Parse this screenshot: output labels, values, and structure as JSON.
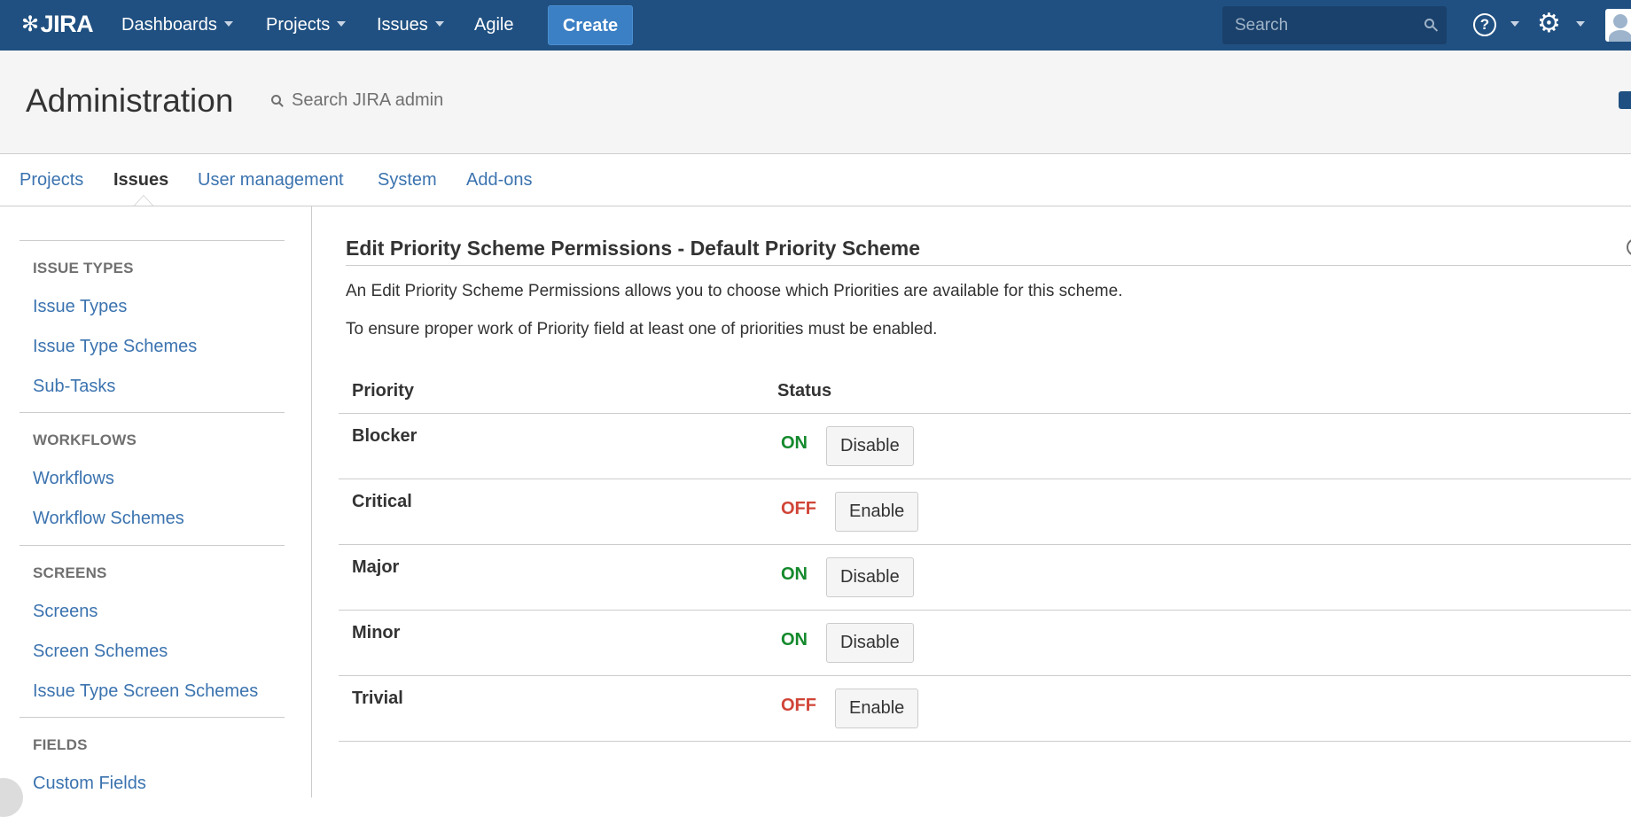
{
  "topnav": {
    "logo": "JIRA",
    "items": [
      {
        "label": "Dashboards",
        "has_dropdown": true
      },
      {
        "label": "Projects",
        "has_dropdown": true
      },
      {
        "label": "Issues",
        "has_dropdown": true
      },
      {
        "label": "Agile",
        "has_dropdown": false
      }
    ],
    "create_label": "Create",
    "search_placeholder": "Search",
    "help_glyph": "?",
    "icons": [
      "search-icon",
      "help-icon",
      "gear-icon",
      "avatar"
    ]
  },
  "admin_header": {
    "title": "Administration",
    "search_placeholder": "Search JIRA admin"
  },
  "admin_tabs": [
    {
      "label": "Projects",
      "active": false
    },
    {
      "label": "Issues",
      "active": true
    },
    {
      "label": "User management",
      "active": false
    },
    {
      "label": "System",
      "active": false
    },
    {
      "label": "Add-ons",
      "active": false
    }
  ],
  "sidebar": {
    "sections": [
      {
        "heading": "ISSUE TYPES",
        "items": [
          "Issue Types",
          "Issue Type Schemes",
          "Sub-Tasks"
        ]
      },
      {
        "heading": "WORKFLOWS",
        "items": [
          "Workflows",
          "Workflow Schemes"
        ]
      },
      {
        "heading": "SCREENS",
        "items": [
          "Screens",
          "Screen Schemes",
          "Issue Type Screen Schemes"
        ]
      },
      {
        "heading": "FIELDS",
        "items": [
          "Custom Fields"
        ]
      }
    ]
  },
  "main": {
    "heading": "Edit Priority Scheme Permissions - Default Priority Scheme",
    "description_1": "An Edit Priority Scheme Permissions allows you to choose which Priorities are available for this scheme.",
    "description_2": "To ensure proper work of Priority field at least one of priorities must be enabled.",
    "table": {
      "columns": [
        "Priority",
        "Status"
      ],
      "rows": [
        {
          "priority": "Blocker",
          "status": "ON",
          "action": "Disable"
        },
        {
          "priority": "Critical",
          "status": "OFF",
          "action": "Enable"
        },
        {
          "priority": "Major",
          "status": "ON",
          "action": "Disable"
        },
        {
          "priority": "Minor",
          "status": "ON",
          "action": "Disable"
        },
        {
          "priority": "Trivial",
          "status": "OFF",
          "action": "Enable"
        }
      ]
    }
  },
  "colors": {
    "header_bg": "#205081",
    "create_button": "#3b7fc4",
    "link": "#3b73af",
    "status_on": "#14892c",
    "status_off": "#d04437"
  }
}
